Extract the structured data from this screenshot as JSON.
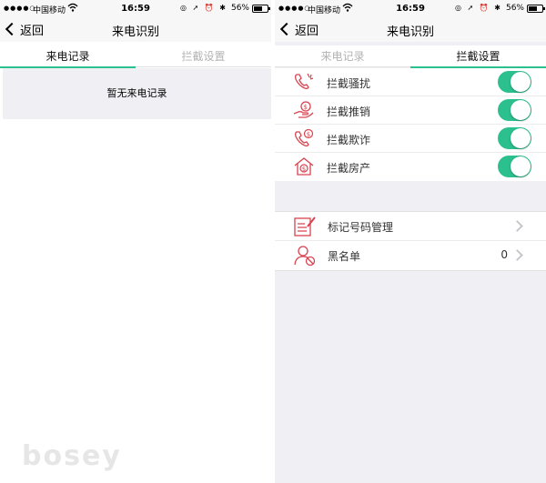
{
  "status": {
    "signal": "●●●●○",
    "carrier": "中国移动",
    "time": "16:59",
    "battery": "56%"
  },
  "left": {
    "back_label": "返回",
    "title": "来电识别",
    "tabs": [
      {
        "label": "来电记录",
        "active": true
      },
      {
        "label": "拦截设置",
        "active": false
      }
    ],
    "empty_message": "暂无来电记录"
  },
  "right": {
    "back_label": "返回",
    "title": "来电识别",
    "tabs": [
      {
        "label": "来电记录",
        "active": false
      },
      {
        "label": "拦截设置",
        "active": true
      }
    ],
    "toggles": [
      {
        "label": "拦截骚扰",
        "icon": "phone-harass-icon",
        "on": true
      },
      {
        "label": "拦截推销",
        "icon": "sales-hand-icon",
        "on": true
      },
      {
        "label": "拦截欺诈",
        "icon": "fraud-phone-icon",
        "on": true
      },
      {
        "label": "拦截房产",
        "icon": "house-icon",
        "on": true
      }
    ],
    "menu": [
      {
        "label": "标记号码管理",
        "icon": "tag-note-icon",
        "value": ""
      },
      {
        "label": "黑名单",
        "icon": "blocked-user-icon",
        "value": "0"
      }
    ]
  },
  "watermark": "bosey",
  "colors": {
    "accent": "#2cc08f",
    "icon_red": "#d9434f",
    "background": "#efeff4"
  }
}
